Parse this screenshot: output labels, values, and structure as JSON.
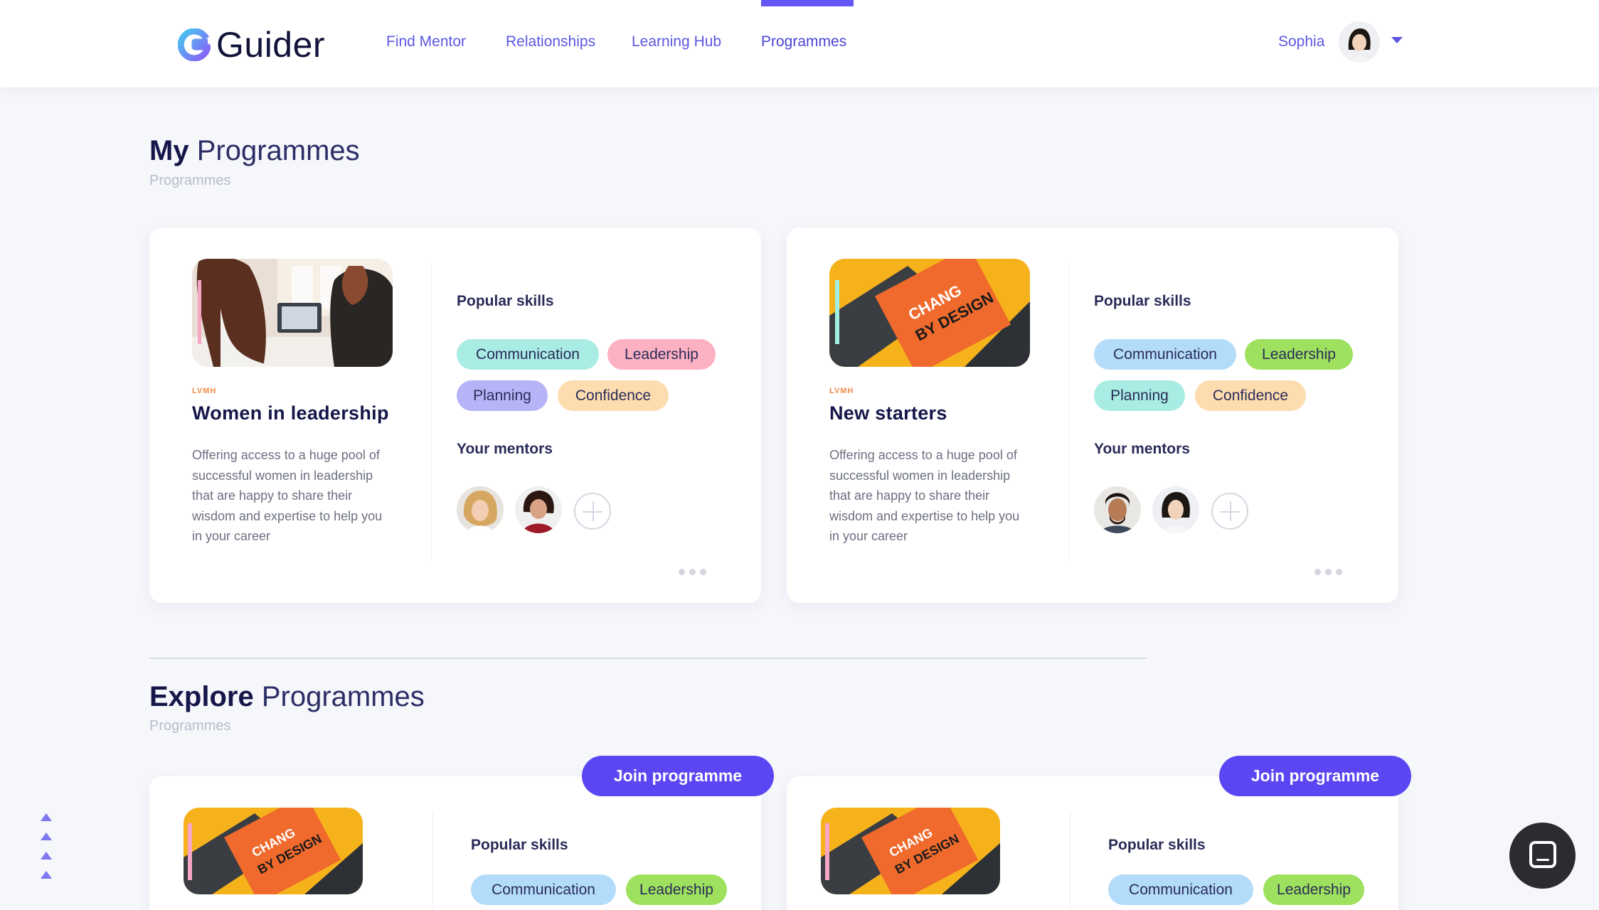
{
  "app": {
    "name": "Guider"
  },
  "nav": {
    "items": [
      {
        "label": "Find Mentor"
      },
      {
        "label": "Relationships"
      },
      {
        "label": "Learning Hub"
      },
      {
        "label": "Programmes"
      }
    ],
    "active": "Programmes"
  },
  "user": {
    "name": "Sophia"
  },
  "my_programmes": {
    "title_bold": "My",
    "title_rest": "Programmes",
    "subtitle": "Programmes",
    "cards": [
      {
        "org": "LVMH",
        "title": "Women in leadership",
        "description": "Offering access to a huge pool of successful women in leadership that are happy to share their wisdom and expertise to help you in your career",
        "skills_label": "Popular skills",
        "skills": [
          "Communication",
          "Leadership",
          "Planning",
          "Confidence"
        ],
        "mentors_label": "Your mentors"
      },
      {
        "org": "LVMH",
        "title": "New starters",
        "description": "Offering access to a huge pool of successful women in leadership that are happy to share their wisdom and expertise to help you in your career",
        "skills_label": "Popular skills",
        "skills": [
          "Communication",
          "Leadership",
          "Planning",
          "Confidence"
        ],
        "mentors_label": "Your mentors"
      }
    ]
  },
  "explore_programmes": {
    "title_bold": "Explore",
    "title_rest": "Programmes",
    "subtitle": "Programmes",
    "cards": [
      {
        "join_label": "Join programme",
        "skills_label": "Popular skills",
        "skills": [
          "Communication",
          "Leadership"
        ]
      },
      {
        "join_label": "Join programme",
        "skills_label": "Popular skills",
        "skills": [
          "Communication",
          "Leadership"
        ]
      }
    ]
  },
  "colors": {
    "accent": "#5a46f2",
    "nav_text": "#5b57e0",
    "chip_cyan": "#a9ece4",
    "chip_blue": "#b3dcfb",
    "chip_pink": "#fcb1c3",
    "chip_green": "#9ee15e",
    "chip_purple": "#b7b3f7",
    "chip_peach": "#fddcb0"
  },
  "icons": [
    "guider-logo-icon",
    "caret-down-icon",
    "add-mentor-icon",
    "more-options-icon",
    "scroll-up-icon",
    "chat-icon"
  ]
}
